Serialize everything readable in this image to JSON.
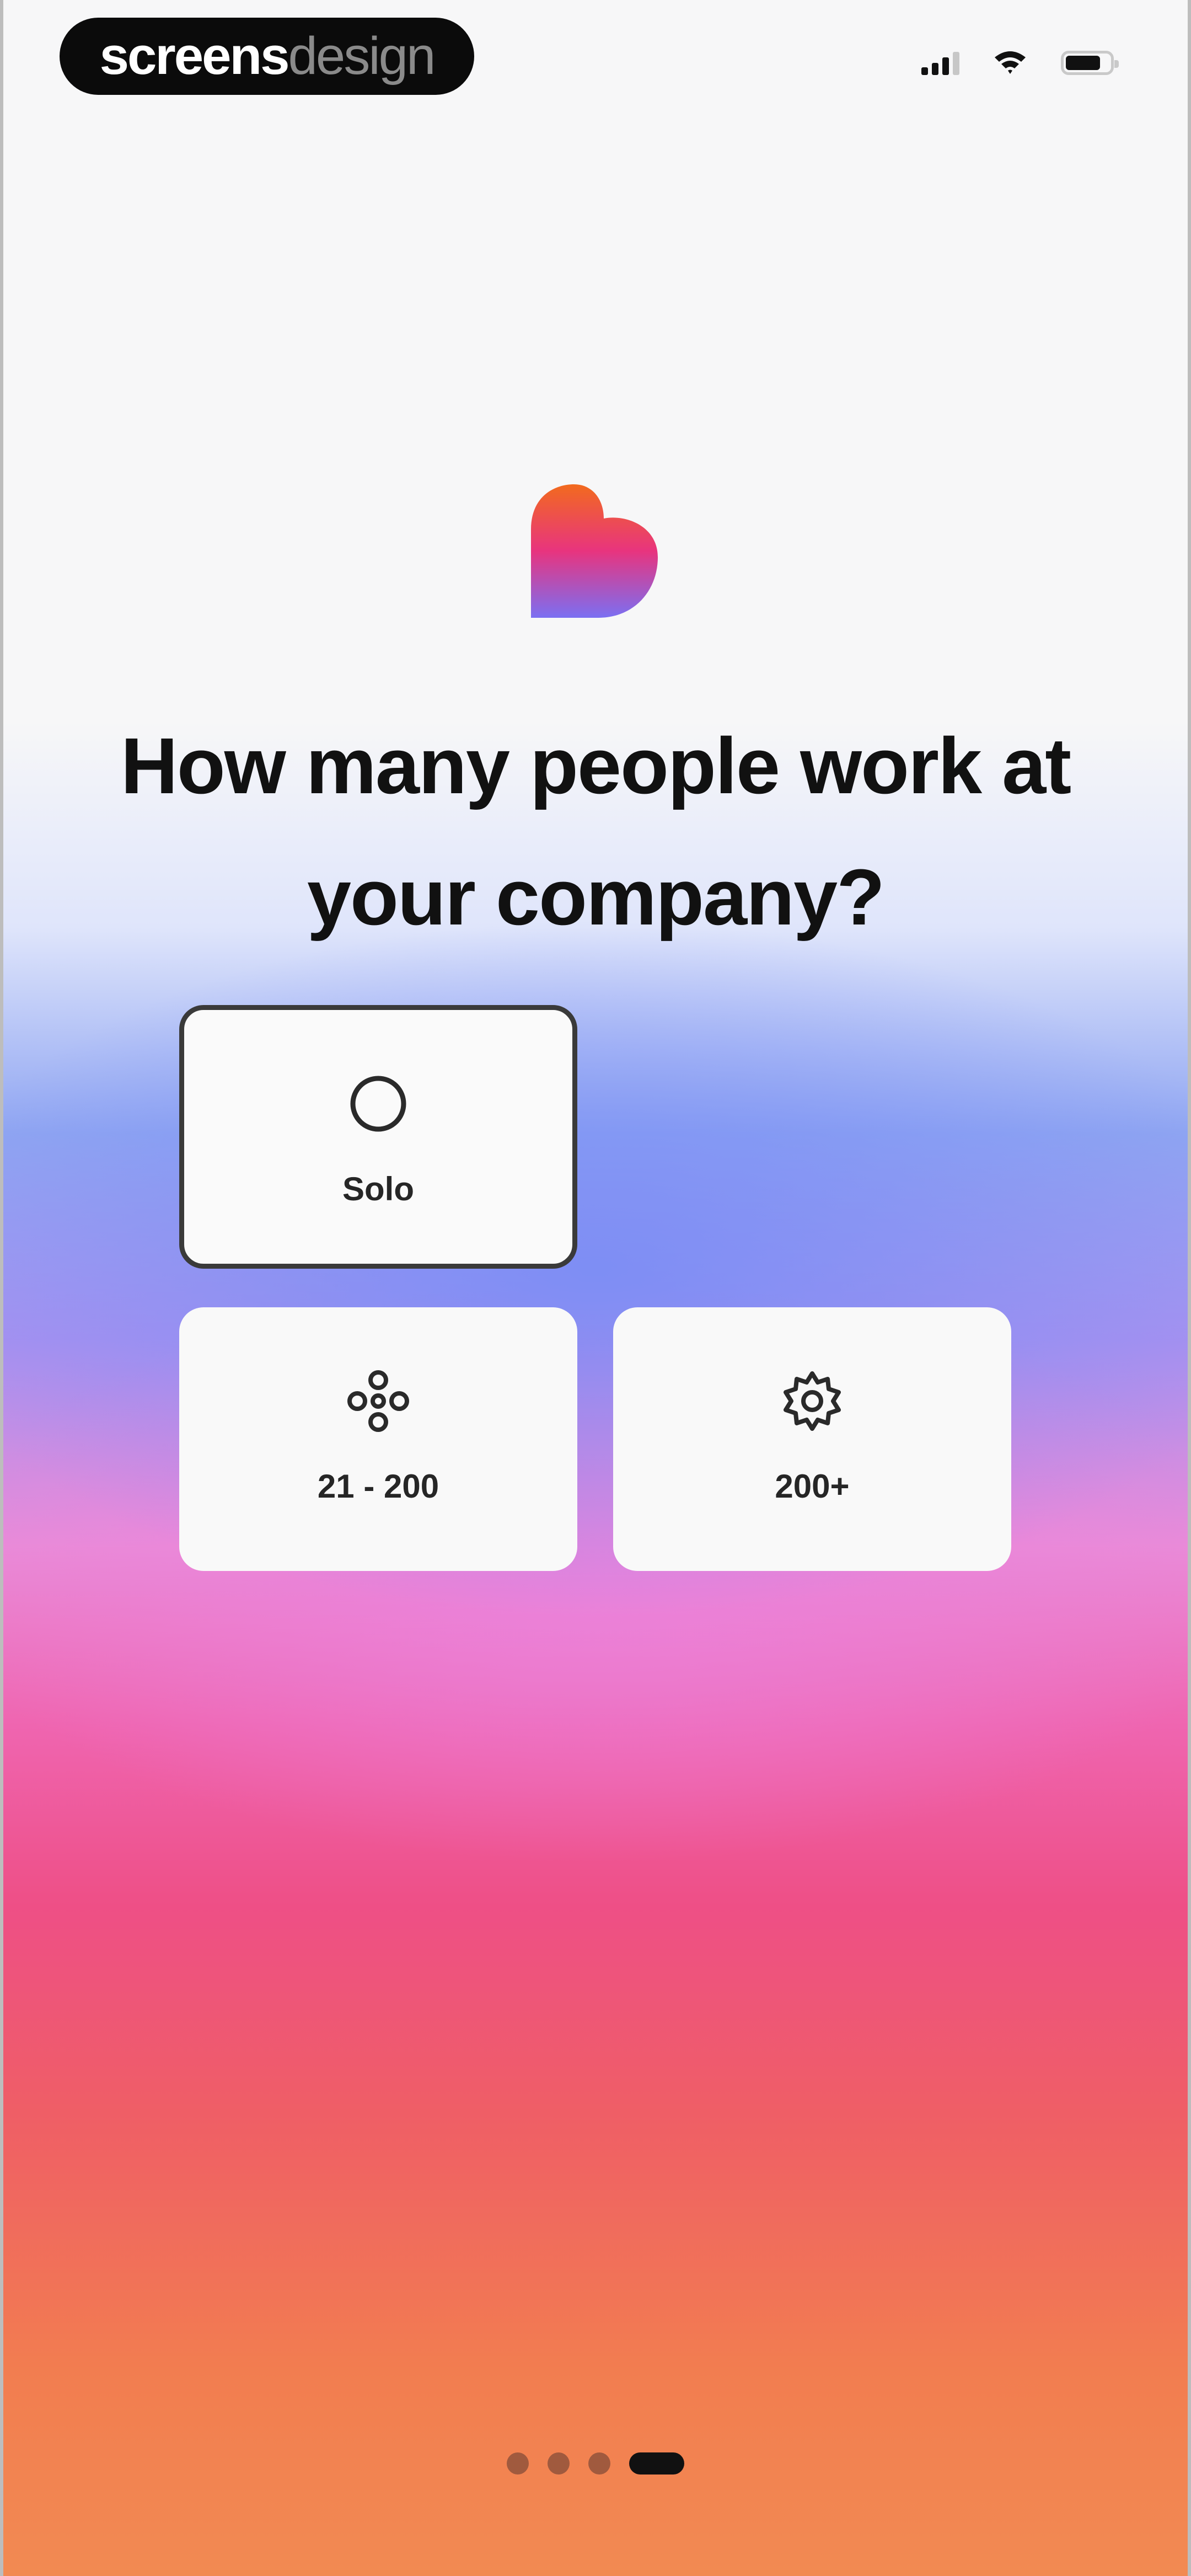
{
  "watermark": {
    "strong": "screens",
    "light": "design"
  },
  "status_bar": {
    "icons": [
      "signal-icon",
      "wifi-icon",
      "battery-icon"
    ]
  },
  "logo": {
    "icon": "heart-logo-icon",
    "colors": [
      "#f26a2a",
      "#e8347e",
      "#7d6cf2"
    ]
  },
  "question": {
    "line1": "How many people work at",
    "line2": "your company?"
  },
  "options": [
    {
      "label": "Solo",
      "icon": "circle-icon",
      "selected": true
    },
    {
      "label": "21 - 200",
      "icon": "cluster-icon",
      "selected": false
    },
    {
      "label": "200+",
      "icon": "gear-icon",
      "selected": false
    }
  ],
  "pagination": {
    "total": 4,
    "current": 4
  }
}
